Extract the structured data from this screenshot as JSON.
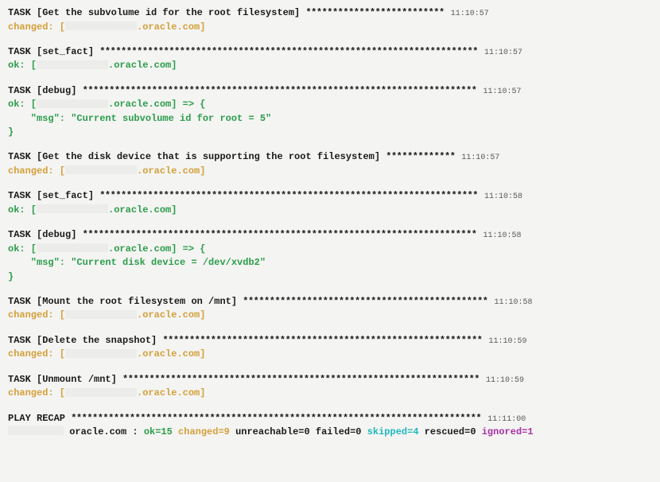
{
  "host_suffix": ".oracle.com",
  "tasks": [
    {
      "title": "TASK [Get the subvolume id for the root filesystem] ",
      "fill": "**************************",
      "time": "11:10:57",
      "status": "changed",
      "status_text": "changed: [",
      "status_close": "]",
      "debug": null
    },
    {
      "title": "TASK [set_fact] ",
      "fill": "***********************************************************************",
      "time": "11:10:57",
      "status": "ok",
      "status_text": "ok: [",
      "status_close": "]",
      "debug": null
    },
    {
      "title": "TASK [debug] ",
      "fill": "**************************************************************************",
      "time": "11:10:57",
      "status": "ok",
      "status_text": "ok: [",
      "status_close": "] => {",
      "debug": {
        "line1": "    \"msg\": \"Current subvolume id for root = 5\"",
        "line2": "}"
      }
    },
    {
      "title": "TASK [Get the disk device that is supporting the root filesystem] ",
      "fill": "*************",
      "time": "11:10:57",
      "status": "changed",
      "status_text": "changed: [",
      "status_close": "]",
      "debug": null
    },
    {
      "title": "TASK [set_fact] ",
      "fill": "***********************************************************************",
      "time": "11:10:58",
      "status": "ok",
      "status_text": "ok: [",
      "status_close": "]",
      "debug": null
    },
    {
      "title": "TASK [debug] ",
      "fill": "**************************************************************************",
      "time": "11:10:58",
      "status": "ok",
      "status_text": "ok: [",
      "status_close": "] => {",
      "debug": {
        "line1": "    \"msg\": \"Current disk device = /dev/xvdb2\"",
        "line2": "}"
      }
    },
    {
      "title": "TASK [Mount the root filesystem on /mnt] ",
      "fill": "**********************************************",
      "time": "11:10:58",
      "status": "changed",
      "status_text": "changed: [",
      "status_close": "]",
      "debug": null
    },
    {
      "title": "TASK [Delete the snapshot] ",
      "fill": "************************************************************",
      "time": "11:10:59",
      "status": "changed",
      "status_text": "changed: [",
      "status_close": "]",
      "debug": null
    },
    {
      "title": "TASK [Unmount /mnt] ",
      "fill": "*******************************************************************",
      "time": "11:10:59",
      "status": "changed",
      "status_text": "changed: [",
      "status_close": "]",
      "debug": null
    }
  ],
  "recap": {
    "title": "PLAY RECAP ",
    "fill": "*****************************************************************************",
    "time": "11:11:00",
    "host_suffix_recap": "oracle.com",
    "sep": " : ",
    "ok": "ok=15",
    "changed": "changed=9",
    "unreachable": "unreachable=0",
    "failed": "failed=0",
    "skipped": "skipped=4",
    "rescued": "rescued=0",
    "ignored": "ignored=1",
    "gap": "    "
  }
}
